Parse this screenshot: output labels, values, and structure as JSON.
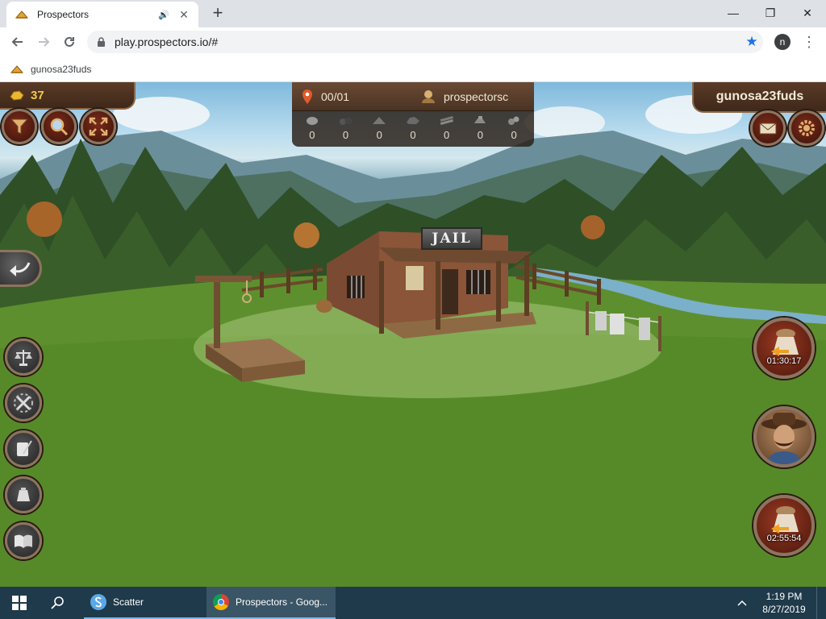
{
  "browser": {
    "tab_title": "Prospectors",
    "new_tab": "+",
    "url": "play.prospectors.io/#",
    "profile_initial": "n",
    "bookmark_label": "gunosa23fuds",
    "window_controls": {
      "minimize": "—",
      "maximize": "❐",
      "close": "✕"
    }
  },
  "game": {
    "gold": "37",
    "claims": "00/01",
    "current_user": "prospectorsc",
    "player_name": "gunosa23fuds",
    "resources": [
      {
        "icon": "stone-icon",
        "value": "0"
      },
      {
        "icon": "coal-icon",
        "value": "0"
      },
      {
        "icon": "clay-icon",
        "value": "0"
      },
      {
        "icon": "ore-icon",
        "value": "0"
      },
      {
        "icon": "wood-icon",
        "value": "0"
      },
      {
        "icon": "iron-icon",
        "value": "0"
      },
      {
        "icon": "gold-ore-icon",
        "value": "0"
      }
    ],
    "building_sign": "JAIL",
    "timers": {
      "first": "01:30:17",
      "second": "02:55:54"
    }
  },
  "taskbar": {
    "scatter_label": "Scatter",
    "chrome_label": "Prospectors - Goog...",
    "time": "1:19 PM",
    "date": "8/27/2019"
  },
  "colors": {
    "gold_text": "#f2c94c",
    "panel_brown": "#4a3324",
    "frame_border": "#8c7460",
    "taskbar": "#1f3a4a"
  }
}
